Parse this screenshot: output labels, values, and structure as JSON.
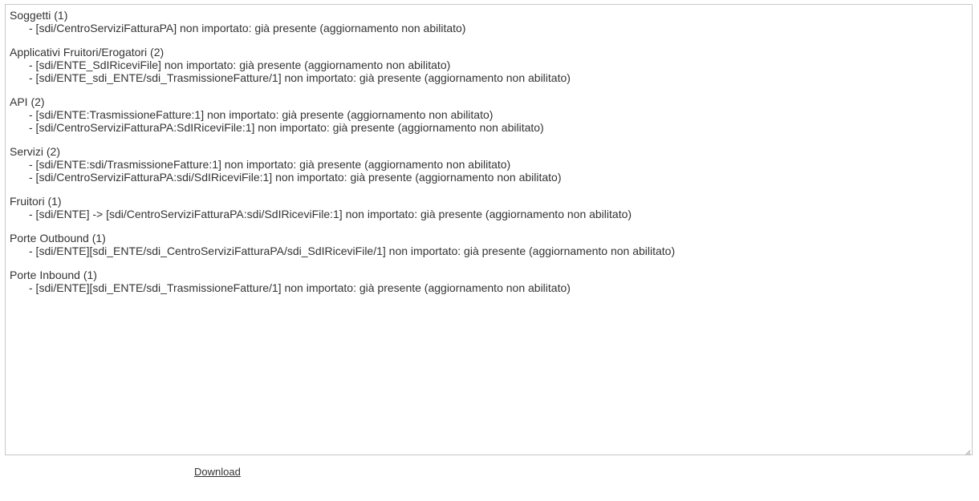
{
  "report": {
    "sections": [
      {
        "title": "Soggetti (1)",
        "entries": [
          "- [sdi/CentroServiziFatturaPA] non importato: già presente (aggiornamento non abilitato)"
        ]
      },
      {
        "title": "Applicativi Fruitori/Erogatori (2)",
        "entries": [
          "- [sdi/ENTE_SdIRiceviFile] non importato: già presente (aggiornamento non abilitato)",
          "- [sdi/ENTE_sdi_ENTE/sdi_TrasmissioneFatture/1] non importato: già presente (aggiornamento non abilitato)"
        ]
      },
      {
        "title": "API (2)",
        "entries": [
          "- [sdi/ENTE:TrasmissioneFatture:1] non importato: già presente (aggiornamento non abilitato)",
          "- [sdi/CentroServiziFatturaPA:SdIRiceviFile:1] non importato: già presente (aggiornamento non abilitato)"
        ]
      },
      {
        "title": "Servizi (2)",
        "entries": [
          "- [sdi/ENTE:sdi/TrasmissioneFatture:1] non importato: già presente (aggiornamento non abilitato)",
          "- [sdi/CentroServiziFatturaPA:sdi/SdIRiceviFile:1] non importato: già presente (aggiornamento non abilitato)"
        ]
      },
      {
        "title": "Fruitori (1)",
        "entries": [
          "- [sdi/ENTE] -> [sdi/CentroServiziFatturaPA:sdi/SdIRiceviFile:1] non importato: già presente (aggiornamento non abilitato)"
        ]
      },
      {
        "title": "Porte Outbound (1)",
        "entries": [
          "- [sdi/ENTE][sdi_ENTE/sdi_CentroServiziFatturaPA/sdi_SdIRiceviFile/1] non importato: già presente (aggiornamento non abilitato)"
        ]
      },
      {
        "title": "Porte Inbound (1)",
        "entries": [
          "- [sdi/ENTE][sdi_ENTE/sdi_TrasmissioneFatture/1] non importato: già presente (aggiornamento non abilitato)"
        ]
      }
    ]
  },
  "download": {
    "label": "Download"
  },
  "icons": {
    "resize_handle": "resize-grip-icon"
  },
  "colors": {
    "text": "#333333",
    "border": "#c8c8c8",
    "background": "#ffffff"
  }
}
